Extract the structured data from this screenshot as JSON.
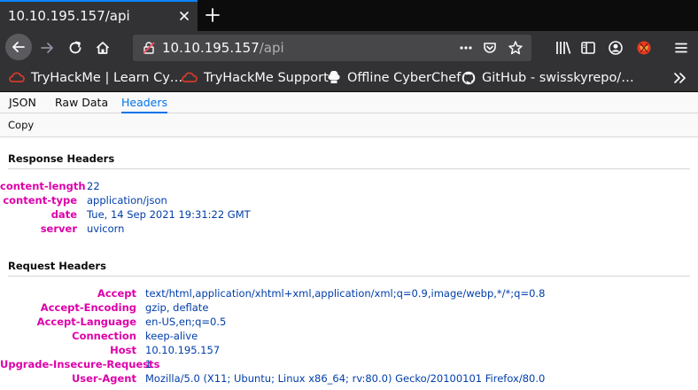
{
  "browser": {
    "tab_title": "10.10.195.157/api",
    "url_host": "10.10.195.157",
    "url_path": "/api"
  },
  "bookmarks": [
    {
      "label": "TryHackMe | Learn Cy…",
      "icon": "tryhackme-icon"
    },
    {
      "label": "TryHackMe Support",
      "icon": "tryhackme-icon"
    },
    {
      "label": "Offline CyberChef",
      "icon": "chef-hat-icon"
    },
    {
      "label": "GitHub - swisskyrepo/…",
      "icon": "github-icon"
    }
  ],
  "viewer": {
    "tabs": [
      "JSON",
      "Raw Data",
      "Headers"
    ],
    "active_tab": "Headers",
    "copy_label": "Copy"
  },
  "response_headers": {
    "title": "Response Headers",
    "rows": [
      {
        "name": "content-length",
        "value": "22"
      },
      {
        "name": "content-type",
        "value": "application/json"
      },
      {
        "name": "date",
        "value": "Tue, 14 Sep 2021 19:31:22 GMT"
      },
      {
        "name": "server",
        "value": "uvicorn"
      }
    ]
  },
  "request_headers": {
    "title": "Request Headers",
    "rows": [
      {
        "name": "Accept",
        "value": "text/html,application/xhtml+xml,application/xml;q=0.9,image/webp,*/*;q=0.8"
      },
      {
        "name": "Accept-Encoding",
        "value": "gzip, deflate"
      },
      {
        "name": "Accept-Language",
        "value": "en-US,en;q=0.5"
      },
      {
        "name": "Connection",
        "value": "keep-alive"
      },
      {
        "name": "Host",
        "value": "10.10.195.157"
      },
      {
        "name": "Upgrade-Insecure-Requests",
        "value": "1"
      },
      {
        "name": "User-Agent",
        "value": "Mozilla/5.0 (X11; Ubuntu; Linux x86_64; rv:80.0) Gecko/20100101 Firefox/80.0"
      }
    ]
  },
  "colors": {
    "header_name": "#dd00a9",
    "header_value": "#003eaa",
    "active_tab": "#0074e8"
  }
}
